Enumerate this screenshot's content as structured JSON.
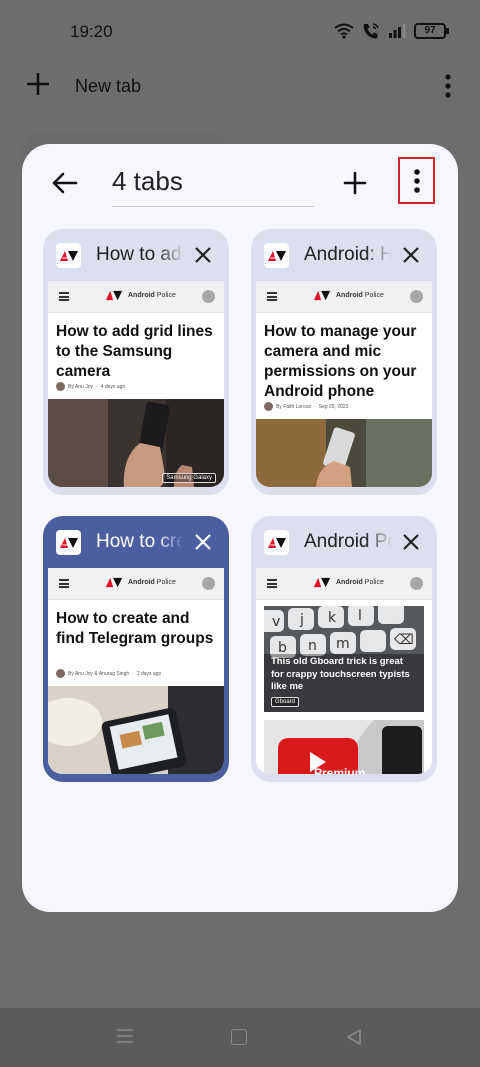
{
  "status_bar": {
    "time": "19:20",
    "battery": "97",
    "icons": [
      "wifi-icon",
      "wifi-calling-icon",
      "signal-icon",
      "battery-icon"
    ]
  },
  "background_toolbar": {
    "new_tab_label": "New tab"
  },
  "tab_switcher": {
    "title": "4 tabs",
    "selected_index": 2,
    "tabs": [
      {
        "title": "How to add grid lines to the Samsung camera",
        "site_name_bold": "Android",
        "site_name": "Police",
        "headline": "How to add grid lines to the Samsung camera",
        "author": "By Anu Joy",
        "date": "4 days ago",
        "chip": "Samsung Galaxy"
      },
      {
        "title": "Android: How to manage your camera and mic permissions",
        "site_name_bold": "Android",
        "site_name": "Police",
        "headline": "How to manage your camera and mic permissions on your Android phone",
        "author": "By Faith Leroux",
        "date": "Sep 29, 2023",
        "chip": ""
      },
      {
        "title": "How to create and find Telegram groups",
        "site_name_bold": "Android",
        "site_name": "Police",
        "headline": "How to create and find Telegram groups",
        "author": "By Anu Joy & Anurag Singh",
        "date": "2 days ago",
        "chip": ""
      },
      {
        "title": "Android Police",
        "site_name_bold": "Android",
        "site_name": "Police",
        "headline": "This old Gboard trick is great for crappy touchscreen typists like me",
        "author": "",
        "date": "",
        "chip": "Gboard",
        "second_headline": "Premium"
      }
    ]
  },
  "colors": {
    "sheet_background": "#f6f7fc",
    "card_background": "#dcdfed",
    "selected_card": "#4b5ea0",
    "highlight_box": "#d0232f",
    "logo_red": "#e0102a"
  }
}
